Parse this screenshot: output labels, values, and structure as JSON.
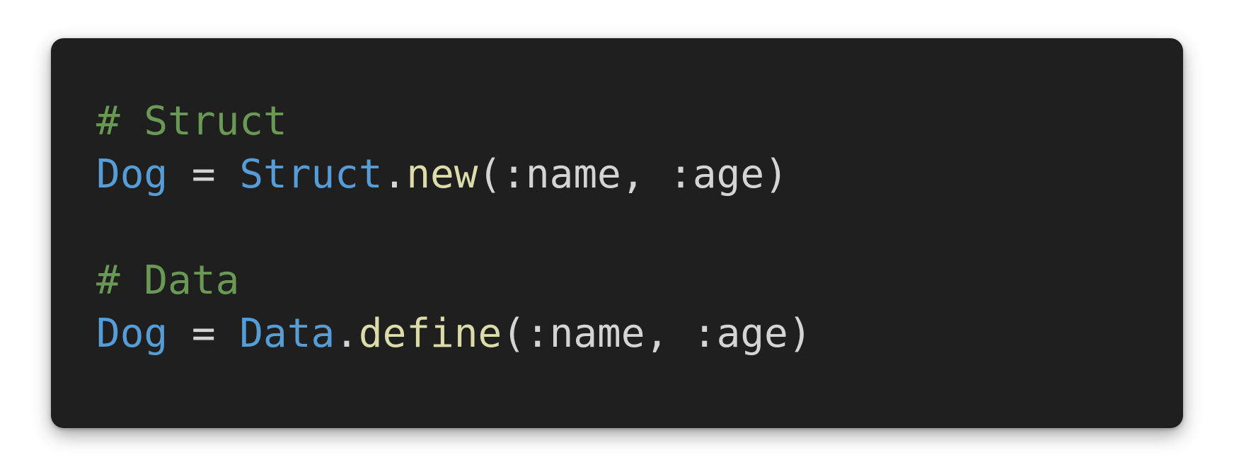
{
  "colors": {
    "background": "#ffffff",
    "card": "#1f1f1f",
    "comment": "#6a9955",
    "constant": "#569cd6",
    "method": "#dcdcaa",
    "plain": "#d4d4d4"
  },
  "code": {
    "line1": {
      "comment": "# Struct"
    },
    "line2": {
      "name": "Dog",
      "op": " = ",
      "klass": "Struct",
      "dot": ".",
      "method": "new",
      "args": "(:name, :age)"
    },
    "line3": {
      "blank": ""
    },
    "line4": {
      "comment": "# Data"
    },
    "line5": {
      "name": "Dog",
      "op": " = ",
      "klass": "Data",
      "dot": ".",
      "method": "define",
      "args": "(:name, :age)"
    }
  }
}
